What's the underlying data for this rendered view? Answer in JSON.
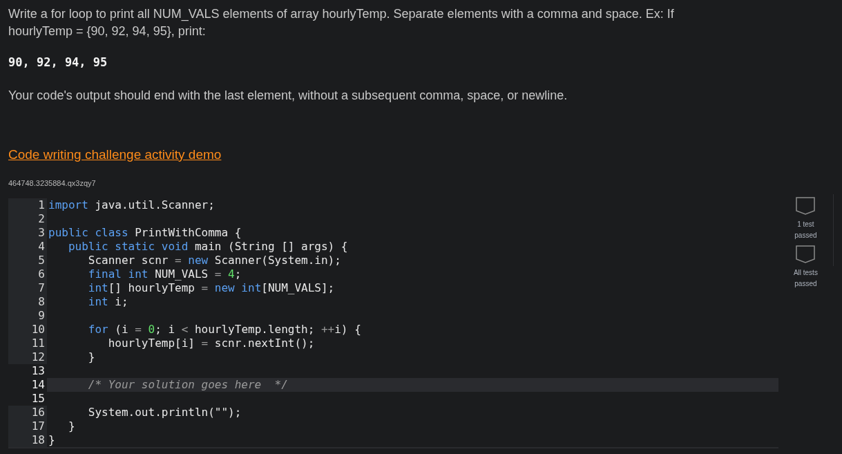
{
  "prompt": {
    "instruction": "Write a for loop to print all NUM_VALS elements of array hourlyTemp. Separate elements with a comma and space. Ex: If hourlyTemp = {90, 92, 94, 95}, print:",
    "example_output": "90, 92, 94, 95",
    "note": "Your code's output should end with the last element, without a subsequent comma, space, or newline."
  },
  "demo_link": "Code writing challenge activity demo",
  "activity_id": "464748.3235884.qx3zqy7",
  "editor": {
    "lines": [
      {
        "number": "1",
        "gutter_highlighted": true,
        "active": false,
        "tokens": [
          {
            "kind": "kw",
            "text": "import"
          },
          {
            "kind": "plain",
            "text": " java.util.Scanner;"
          }
        ]
      },
      {
        "number": "2",
        "gutter_highlighted": true,
        "active": false
      },
      {
        "number": "3",
        "gutter_highlighted": true,
        "active": false,
        "tokens": [
          {
            "kind": "kw",
            "text": "public class"
          },
          {
            "kind": "plain",
            "text": " PrintWithComma {"
          }
        ]
      },
      {
        "number": "4",
        "gutter_highlighted": true,
        "active": false,
        "tokens": [
          {
            "kind": "kw",
            "text": "   public static void"
          },
          {
            "kind": "plain",
            "text": " main (String [] args) {"
          }
        ]
      },
      {
        "number": "5",
        "gutter_highlighted": true,
        "active": false,
        "tokens": [
          {
            "kind": "plain",
            "text": "      Scanner scnr "
          },
          {
            "kind": "op",
            "text": "="
          },
          {
            "kind": "kw",
            "text": " new"
          },
          {
            "kind": "plain",
            "text": " Scanner(System.in);"
          }
        ]
      },
      {
        "number": "6",
        "gutter_highlighted": true,
        "active": false,
        "tokens": [
          {
            "kind": "kw",
            "text": "      final int"
          },
          {
            "kind": "plain",
            "text": " NUM_VALS "
          },
          {
            "kind": "op",
            "text": "="
          },
          {
            "kind": "num",
            "text": " 4"
          },
          {
            "kind": "plain",
            "text": ";"
          }
        ]
      },
      {
        "number": "7",
        "gutter_highlighted": true,
        "active": false,
        "tokens": [
          {
            "kind": "kw",
            "text": "      int"
          },
          {
            "kind": "plain",
            "text": "[] hourlyTemp "
          },
          {
            "kind": "op",
            "text": "="
          },
          {
            "kind": "kw",
            "text": " new int"
          },
          {
            "kind": "plain",
            "text": "[NUM_VALS];"
          }
        ]
      },
      {
        "number": "8",
        "gutter_highlighted": true,
        "active": false,
        "tokens": [
          {
            "kind": "kw",
            "text": "      int"
          },
          {
            "kind": "plain",
            "text": " i;"
          }
        ]
      },
      {
        "number": "9",
        "gutter_highlighted": true,
        "active": false
      },
      {
        "number": "10",
        "gutter_highlighted": true,
        "active": false,
        "tokens": [
          {
            "kind": "kw",
            "text": "      for"
          },
          {
            "kind": "plain",
            "text": " (i "
          },
          {
            "kind": "op",
            "text": "="
          },
          {
            "kind": "num",
            "text": " 0"
          },
          {
            "kind": "plain",
            "text": "; i "
          },
          {
            "kind": "op",
            "text": "<"
          },
          {
            "kind": "plain",
            "text": " hourlyTemp.length; "
          },
          {
            "kind": "op",
            "text": "++"
          },
          {
            "kind": "plain",
            "text": "i) {"
          }
        ]
      },
      {
        "number": "11",
        "gutter_highlighted": true,
        "active": false,
        "tokens": [
          {
            "kind": "plain",
            "text": "         hourlyTemp[i] "
          },
          {
            "kind": "op",
            "text": "="
          },
          {
            "kind": "plain",
            "text": " scnr.nextInt();"
          }
        ]
      },
      {
        "number": "12",
        "gutter_highlighted": true,
        "active": false,
        "tokens": [
          {
            "kind": "plain",
            "text": "      }"
          }
        ]
      },
      {
        "number": "13",
        "gutter_highlighted": false,
        "active": false
      },
      {
        "number": "14",
        "gutter_highlighted": false,
        "active": true,
        "tokens": [
          {
            "kind": "comment",
            "text": "      /* Your solution goes here  */"
          }
        ]
      },
      {
        "number": "15",
        "gutter_highlighted": false,
        "active": false
      },
      {
        "number": "16",
        "gutter_highlighted": true,
        "active": false,
        "tokens": [
          {
            "kind": "plain",
            "text": "      System.out.println(\"\");"
          }
        ]
      },
      {
        "number": "17",
        "gutter_highlighted": true,
        "active": false,
        "tokens": [
          {
            "kind": "plain",
            "text": "   }"
          }
        ]
      },
      {
        "number": "18",
        "gutter_highlighted": true,
        "active": false,
        "tokens": [
          {
            "kind": "plain",
            "text": "}"
          }
        ]
      }
    ]
  },
  "tests": [
    {
      "label": "1 test passed",
      "passed": false
    },
    {
      "label": "All tests passed",
      "passed": false
    }
  ]
}
